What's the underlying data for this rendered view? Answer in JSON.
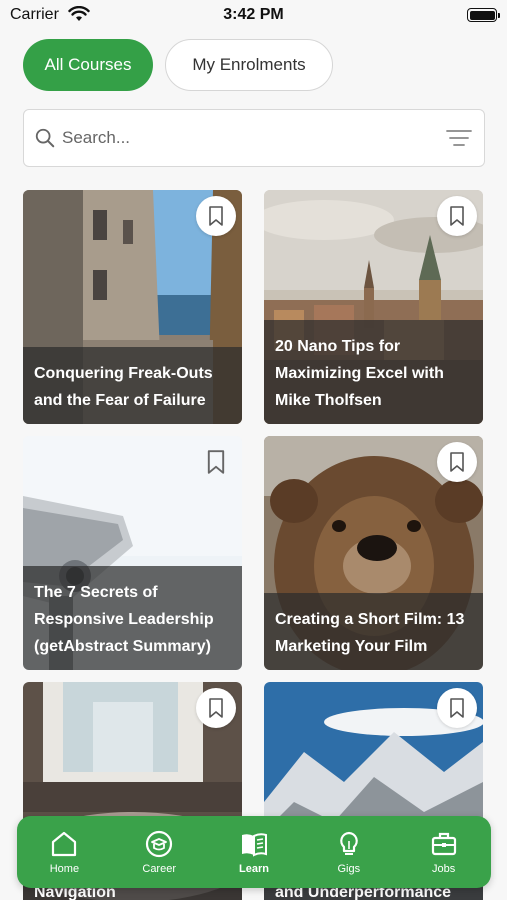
{
  "status": {
    "carrier": "Carrier",
    "time": "3:42 PM"
  },
  "tabs": [
    {
      "label": "All Courses",
      "active": true
    },
    {
      "label": "My Enrolments",
      "active": false
    }
  ],
  "search": {
    "placeholder": "Search..."
  },
  "courses": [
    {
      "title": "Conquering Freak-Outs and the Fear of Failure"
    },
    {
      "title": "20 Nano Tips for Maximizing Excel with Mike Tholfsen"
    },
    {
      "title": "The 7 Secrets of Responsive Leadership (getAbstract Summary)"
    },
    {
      "title": "Creating a Short Film: 13 Marketing Your Film"
    },
    {
      "title": "Navigation"
    },
    {
      "title": "and Underperformance"
    }
  ],
  "nav": [
    {
      "label": "Home",
      "icon": "home-icon"
    },
    {
      "label": "Career",
      "icon": "career-icon"
    },
    {
      "label": "Learn",
      "icon": "learn-icon",
      "active": true
    },
    {
      "label": "Gigs",
      "icon": "gigs-icon"
    },
    {
      "label": "Jobs",
      "icon": "jobs-icon"
    }
  ],
  "colors": {
    "accent": "#34a047",
    "nav": "#3aa24a",
    "background": "#f7f7f7"
  }
}
